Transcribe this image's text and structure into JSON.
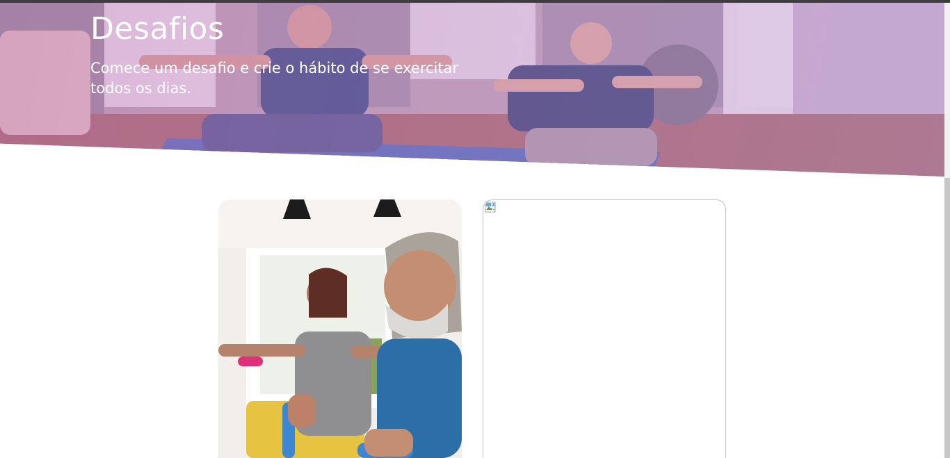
{
  "hero": {
    "title": "Desafios",
    "subtitle": "Comece um desafio e crie o hábito de se exercitar todos os dias.",
    "image": "seniors-exercising-on-mat-photo",
    "overlay_color": "#c88cc8"
  },
  "challenges": {
    "cards": [
      {
        "image": "senior-man-woman-resistance-band-dumbbells-photo"
      },
      {
        "image": "broken-image-icon"
      }
    ]
  },
  "colors": {
    "topbar": "#3d3d3d",
    "overlay": "#c88cc8",
    "background": "#ffffff"
  }
}
